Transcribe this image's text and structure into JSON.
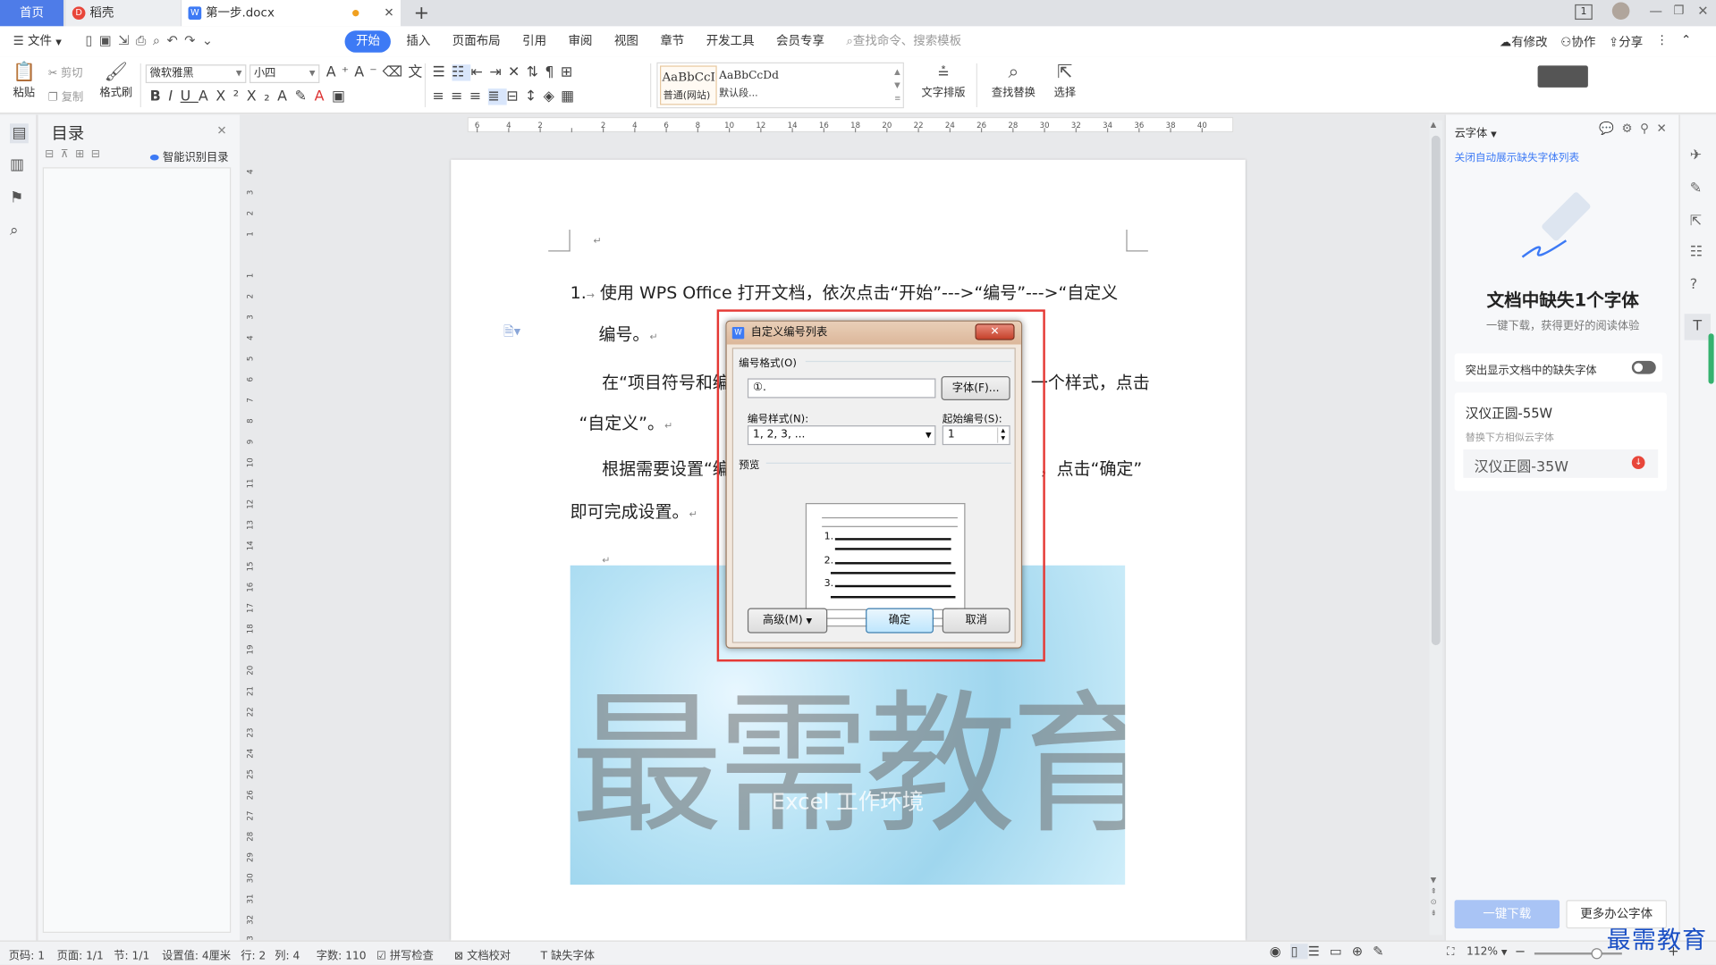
{
  "tabs": {
    "home": "首页",
    "daoke": "稻壳",
    "doc": "第一步.docx",
    "add": "+"
  },
  "window_ctrl": {
    "badge": "1"
  },
  "menu": {
    "file": "文件",
    "items": [
      "开始",
      "插入",
      "页面布局",
      "引用",
      "审阅",
      "视图",
      "章节",
      "开发工具",
      "会员专享"
    ],
    "active_index": 0,
    "search_placeholder": "查找命令、搜索模板",
    "right": [
      "有修改",
      "协作",
      "分享"
    ]
  },
  "ribbon": {
    "paste": "粘贴",
    "cut": "剪切",
    "copy": "复制",
    "format_painter": "格式刷",
    "font_name": "微软雅黑",
    "font_size": "小四",
    "style1_preview": "AaBbCcI",
    "style1_name": "普通(网站)",
    "style2_preview": "AaBbCcDd",
    "style2_name": "默认段...",
    "text_layout": "文字排版",
    "find_replace": "查找替换",
    "select": "选择"
  },
  "toc": {
    "title": "目录",
    "smart": "智能识别目录"
  },
  "ruler": {
    "h_ticks": [
      "6",
      "4",
      "2",
      "",
      "2",
      "4",
      "6",
      "8",
      "10",
      "12",
      "14",
      "16",
      "18",
      "20",
      "22",
      "24",
      "26",
      "28",
      "30",
      "32",
      "34",
      "36",
      "38",
      "40"
    ],
    "v_ticks": [
      "4",
      "3",
      "2",
      "1",
      "",
      "1",
      "2",
      "3",
      "4",
      "5",
      "6",
      "7",
      "8",
      "9",
      "10",
      "11",
      "12",
      "13",
      "14",
      "15",
      "16",
      "17",
      "18",
      "19",
      "20",
      "21",
      "22",
      "23",
      "24",
      "25",
      "26",
      "27",
      "28",
      "29",
      "30",
      "31",
      "32",
      "33"
    ]
  },
  "document": {
    "p1_num": "1.",
    "p1_line1": "使用 WPS Office 打开文档，依次点击“开始”--->“编号”--->“自定义",
    "p1_line2": "编号。",
    "p2_line1": "在“项目符号和编",
    "p2_line1_tail": "一个样式，点击",
    "p2_line2": "“自定义”。",
    "p3_line1": "根据需要设置“编",
    "p3_line1_tail": "，点击“确定”",
    "p3_line2": "即可完成设置。",
    "watermark": "最需教育",
    "image_caption": "Excel 工作环境"
  },
  "dialog": {
    "title": "自定义编号列表",
    "format_group": "编号格式(O)",
    "format_value": "①.",
    "font_btn": "字体(F)...",
    "style_label": "编号样式(N):",
    "style_value": "1, 2, 3, ...",
    "start_label": "起始编号(S):",
    "start_value": "1",
    "preview_label": "预览",
    "preview_nums": [
      "1.",
      "2.",
      "3."
    ],
    "advanced_btn": "高级(M)",
    "ok_btn": "确定",
    "cancel_btn": "取消",
    "close": "✕"
  },
  "right_panel": {
    "header": "云字体",
    "link": "关闭自动展示缺失字体列表",
    "headline": "文档中缺失1个字体",
    "sub": "一键下载，获得更好的阅读体验",
    "toggle_label": "突出显示文档中的缺失字体",
    "missing_font": "汉仪正圆-55W",
    "replace_hint": "替换下方相似云字体",
    "replacement": "汉仪正圆-35W",
    "download_btn": "一键下载",
    "more_btn": "更多办公字体"
  },
  "status": {
    "page": "页码: 1",
    "pages": "页面: 1/1",
    "section": "节: 1/1",
    "setting": "设置值: 4厘米",
    "row": "行: 2",
    "col": "列: 4",
    "words": "字数: 110",
    "spell": "拼写检查",
    "proof": "文档校对",
    "missing": "缺失字体",
    "zoom": "112%"
  },
  "logo_text": "最需教育",
  "colors": {
    "accent": "#3d7af5",
    "red_highlight": "#e53935",
    "dialog_title": "#dcb79a"
  }
}
